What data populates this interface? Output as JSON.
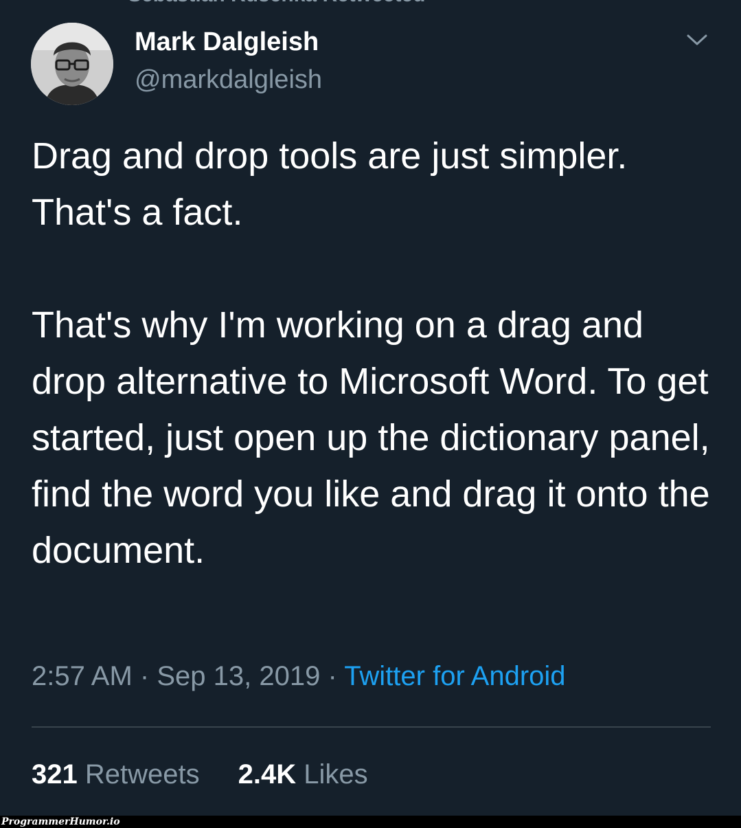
{
  "retweet_banner": {
    "icon": "retweet-icon",
    "text": "Sebastian Kuschka Retweeted"
  },
  "tweet": {
    "author": {
      "avatar": "avatar-photo",
      "name": "Mark Dalgleish",
      "handle": "@markdalgleish"
    },
    "menu_icon": "chevron-down-icon",
    "text_paragraphs": [
      "Drag and drop tools are just simpler. That's a fact.",
      "That's why I'm working on a drag and drop alternative to Microsoft Word. To get started, just open up the dictionary panel, find the word you like and drag it onto the document."
    ],
    "time": "2:57 AM",
    "separator": "·",
    "date": "Sep 13, 2019",
    "source": "Twitter for Android",
    "stats": {
      "retweets_count": "321",
      "retweets_label": "Retweets",
      "likes_count": "2.4K",
      "likes_label": "Likes"
    }
  },
  "watermark": "ProgrammerHumor.io",
  "colors": {
    "background": "#15202b",
    "text_primary": "#ffffff",
    "text_secondary": "#8899a6",
    "link": "#1da1f2",
    "divider": "#38444d"
  }
}
